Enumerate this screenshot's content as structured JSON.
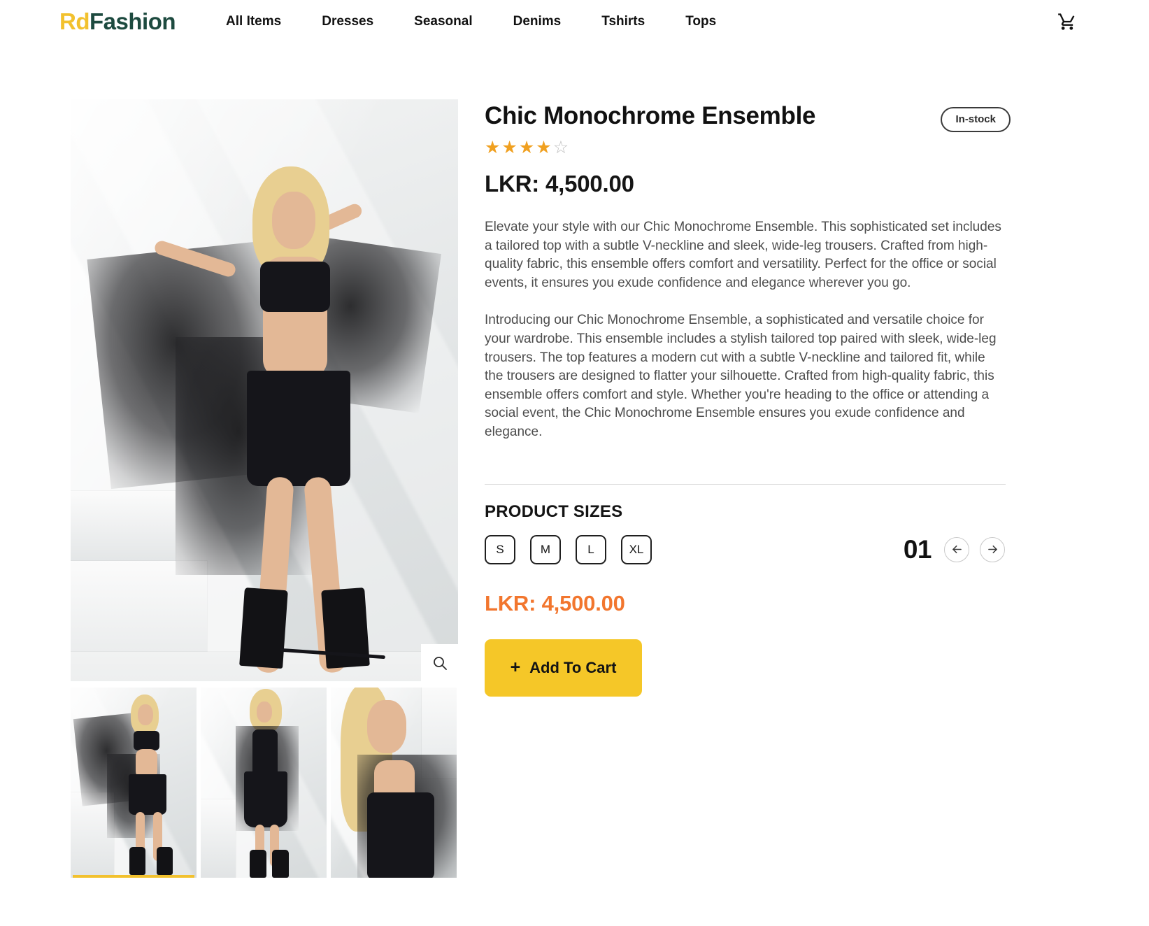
{
  "header": {
    "brand_prefix": "Rd",
    "brand_suffix": "Fashion",
    "brand_prefix_color": "#F2C12E",
    "brand_suffix_color": "#1D4A3F",
    "nav": [
      {
        "label": "All Items"
      },
      {
        "label": "Dresses"
      },
      {
        "label": "Seasonal"
      },
      {
        "label": "Denims"
      },
      {
        "label": "Tshirts"
      },
      {
        "label": "Tops"
      }
    ],
    "cart_icon": "shopping-cart-icon"
  },
  "gallery": {
    "zoom_icon": "magnifier-icon",
    "active_thumb_index": 0,
    "active_indicator_color": "#F2C12E",
    "thumbnails": [
      {
        "alt": "Model in black tulle top with arms outstretched"
      },
      {
        "alt": "Model in sheer black tulle dress standing"
      },
      {
        "alt": "Close-up of model in sheer black tulle dress"
      }
    ],
    "hero": {
      "alt": "Model wearing black sheer tulle ensemble with combat boots"
    }
  },
  "product": {
    "title": "Chic Monochrome Ensemble",
    "stock_badge": "In-stock",
    "rating": {
      "value": 4,
      "max": 5,
      "filled_color": "#F0A020",
      "empty_color": "#BDBDBD",
      "filled_glyph": "★",
      "empty_glyph": "☆"
    },
    "price": "LKR: 4,500.00",
    "price_accent": "LKR: 4,500.00",
    "price_accent_color": "#F2762E",
    "description_1": "Elevate your style with our Chic Monochrome Ensemble. This sophisticated set includes a tailored top with a subtle V-neckline and sleek, wide-leg trousers. Crafted from high-quality fabric, this ensemble offers comfort and versatility. Perfect for the office or social events, it ensures you exude confidence and elegance wherever you go.",
    "description_2": "Introducing our Chic Monochrome Ensemble, a sophisticated and versatile choice for your wardrobe. This ensemble includes a stylish tailored top paired with sleek, wide-leg trousers. The top features a modern cut with a subtle V-neckline and tailored fit, while the trousers are designed to flatter your silhouette. Crafted from high-quality fabric, this ensemble offers comfort and style. Whether you're heading to the office or attending a social event, the Chic Monochrome Ensemble ensures you exude confidence and elegance."
  },
  "sizes": {
    "heading": "PRODUCT SIZES",
    "options": [
      {
        "label": "S"
      },
      {
        "label": "M"
      },
      {
        "label": "L"
      },
      {
        "label": "XL"
      }
    ]
  },
  "quantity": {
    "value": "01",
    "decrement_icon": "arrow-left-icon",
    "increment_icon": "arrow-right-icon"
  },
  "actions": {
    "add_to_cart_plus": "+",
    "add_to_cart_label": "Add To Cart",
    "add_to_cart_bg": "#F5C728"
  }
}
